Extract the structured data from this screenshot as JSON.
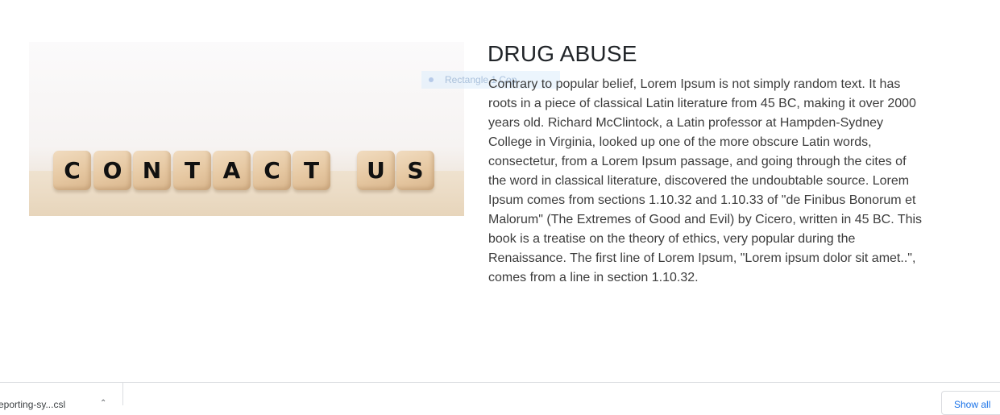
{
  "hero_image": {
    "alt": "CONTACT US",
    "letters": [
      "C",
      "O",
      "N",
      "T",
      "A",
      "C",
      "T",
      "U",
      "S"
    ]
  },
  "overlay_tag": {
    "text": "Rectangle 1 Cop"
  },
  "article": {
    "title": "DRUG ABUSE",
    "body": "Contrary to popular belief, Lorem Ipsum is not simply random text. It has roots in a piece of classical Latin literature from 45 BC, making it over 2000 years old. Richard McClintock, a Latin professor at Hampden-Sydney College in Virginia, looked up one of the more obscure Latin words, consectetur, from a Lorem Ipsum passage, and going through the cites of the word in classical literature, discovered the undoubtable source. Lorem Ipsum comes from sections 1.10.32 and 1.10.33 of \"de Finibus Bonorum et Malorum\" (The Extremes of Good and Evil) by Cicero, written in 45 BC. This book is a treatise on the theory of ethics, very popular during the Renaissance. The first line of Lorem Ipsum, \"Lorem ipsum dolor sit amet..\", comes from a line in section 1.10.32."
  },
  "download_bar": {
    "file_name": "reporting-sy...csl",
    "caret_icon": "chevron-up-icon",
    "show_all_label": "Show all"
  }
}
